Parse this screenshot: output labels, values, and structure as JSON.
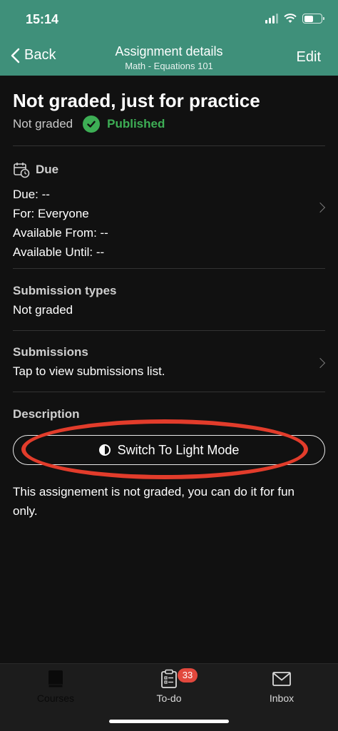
{
  "status_bar": {
    "time": "15:14"
  },
  "nav": {
    "back_label": "Back",
    "title": "Assignment details",
    "subtitle": "Math - Equations 101",
    "edit_label": "Edit"
  },
  "assignment": {
    "title": "Not graded, just for practice",
    "grade_status": "Not graded",
    "publish_status": "Published"
  },
  "due_section": {
    "heading": "Due",
    "lines": [
      "Due: --",
      "For: Everyone",
      "Available From: --",
      "Available Until: --"
    ]
  },
  "submission_types": {
    "label": "Submission types",
    "value": "Not graded"
  },
  "submissions": {
    "label": "Submissions",
    "value": "Tap to view submissions list."
  },
  "description": {
    "label": "Description",
    "toggle_label": "Switch To Light Mode",
    "text": "This assignement is not graded, you can do it for fun only."
  },
  "tabbar": {
    "items": [
      {
        "label": "Courses",
        "icon": "book-icon"
      },
      {
        "label": "To-do",
        "icon": "clipboard-icon",
        "badge": "33"
      },
      {
        "label": "Inbox",
        "icon": "envelope-icon"
      }
    ]
  },
  "colors": {
    "header": "#3f907a",
    "published": "#3dae55",
    "badge": "#e2483d",
    "annotation": "#e23c2b"
  }
}
